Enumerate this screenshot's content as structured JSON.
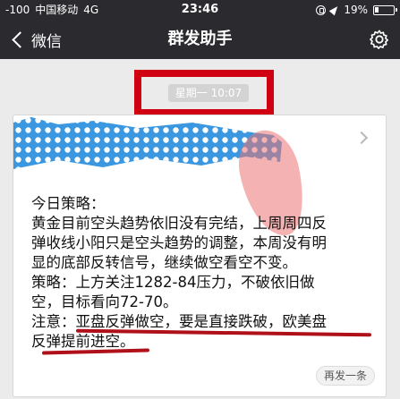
{
  "status_bar": {
    "signal": "-100",
    "carrier": "中国移动",
    "network": "4G",
    "time": "23:46",
    "battery": "19%"
  },
  "nav": {
    "back_label": "微信",
    "title": "群发助手"
  },
  "message": {
    "timestamp": "星期一 10:07",
    "lines": [
      "今日策略：",
      "黄金目前空头趋势依旧没有完结，上周周四反",
      "弹收线小阳只是空头趋势的调整，本周没有明",
      "显的底部反转信号，继续做空看空不变。",
      "策略：上方关注1282-84压力，不破依旧做",
      "空，目标看向72-70。"
    ],
    "note_line1": "注意：亚盘反弹做空，要是直接跌破，欧美盘",
    "note_line2": "反弹提前进空。",
    "resend_label": "再发一条"
  },
  "colors": {
    "header_bg": "#2b2b2f",
    "page_bg": "#ebebeb",
    "marker_red": "#d00012",
    "banner_blue": "#3b98e0"
  }
}
